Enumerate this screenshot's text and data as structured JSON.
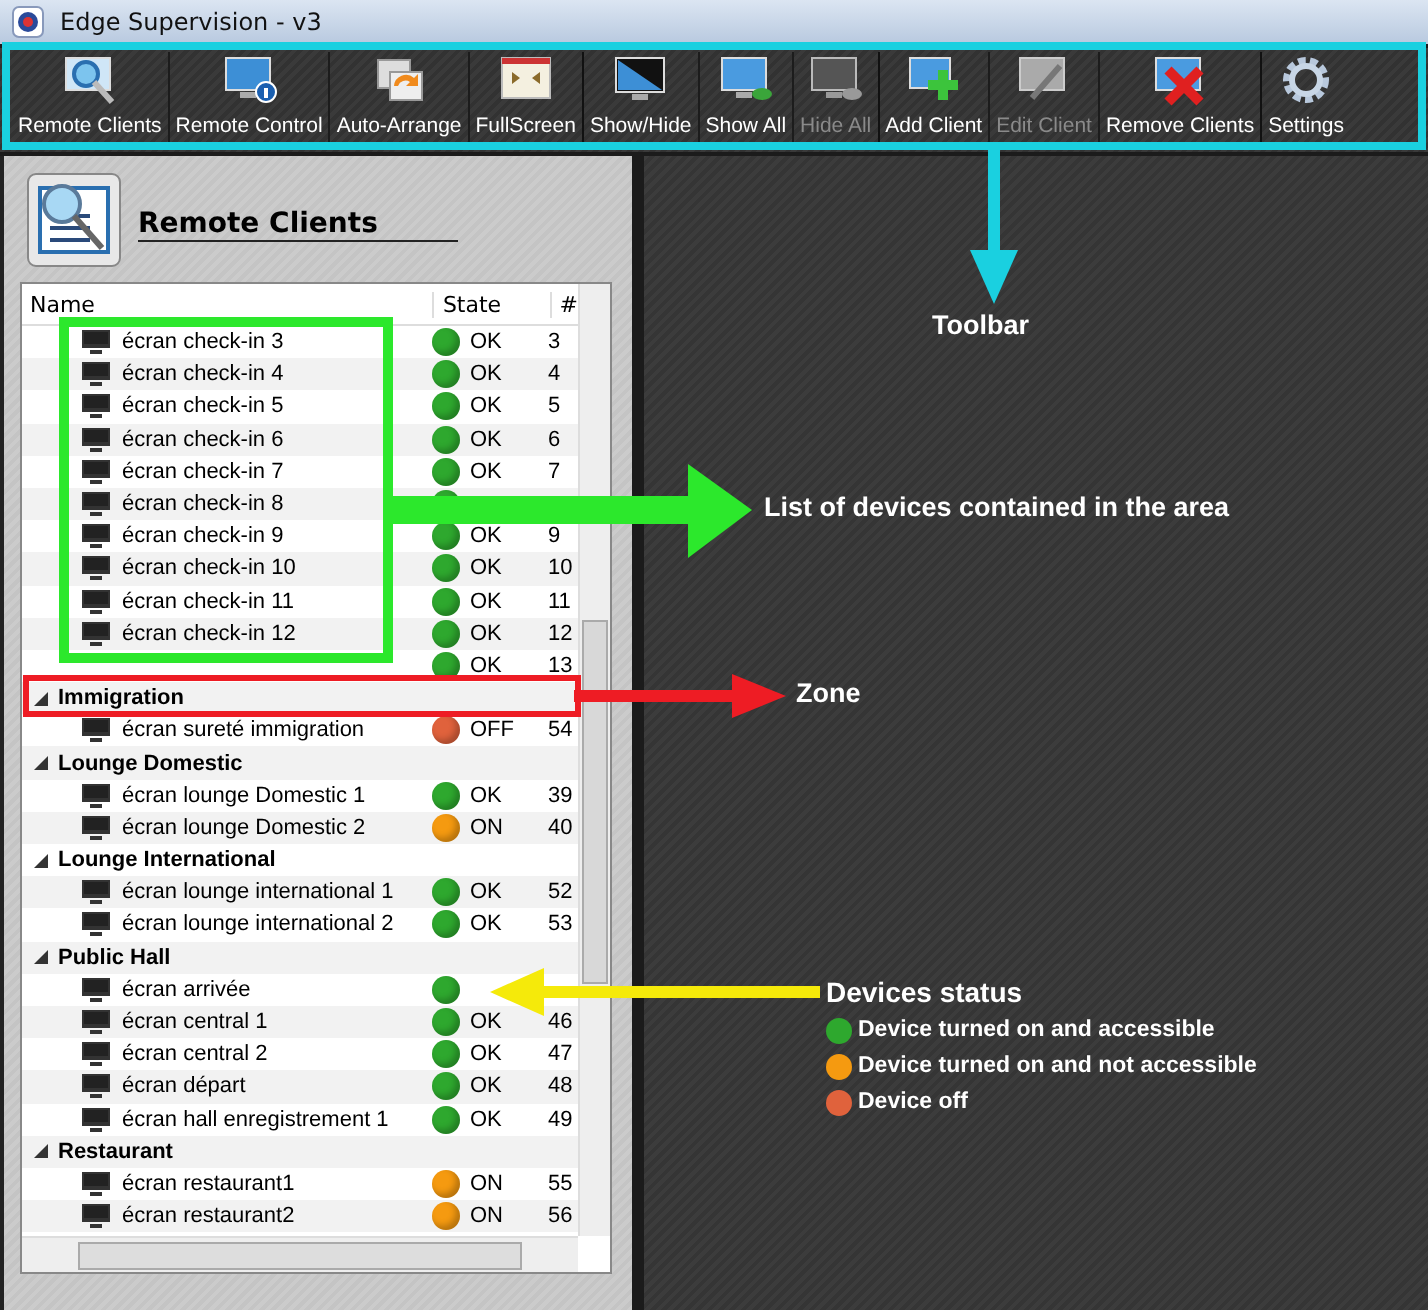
{
  "window": {
    "title": "Edge Supervision - v3"
  },
  "toolbar": {
    "groups": [
      [
        {
          "label": "Remote Clients",
          "kind": "search",
          "disabled": false
        },
        {
          "label": "Remote Control",
          "kind": "info",
          "disabled": false
        },
        {
          "label": "Auto-Arrange",
          "kind": "arrange",
          "disabled": false
        },
        {
          "label": "FullScreen",
          "kind": "fullscreen",
          "disabled": false
        }
      ],
      [
        {
          "label": "Show/Hide",
          "kind": "showhide",
          "disabled": false
        },
        {
          "label": "Show All",
          "kind": "showall",
          "disabled": false
        },
        {
          "label": "Hide All",
          "kind": "hideall",
          "disabled": true
        }
      ],
      [
        {
          "label": "Add Client",
          "kind": "add",
          "disabled": false
        },
        {
          "label": "Edit Client",
          "kind": "edit",
          "disabled": true
        },
        {
          "label": "Remove Clients",
          "kind": "remove",
          "disabled": false
        }
      ],
      [
        {
          "label": "Settings",
          "kind": "settings",
          "disabled": false
        }
      ]
    ]
  },
  "panel": {
    "title": "Remote Clients",
    "columns": [
      "Name",
      "State",
      "#"
    ],
    "tree": [
      {
        "kind": "device",
        "name": "écran check-in 3",
        "state": "OK",
        "number": "3",
        "color": "#2ea82e"
      },
      {
        "kind": "device",
        "name": "écran check-in 4",
        "state": "OK",
        "number": "4",
        "color": "#2ea82e"
      },
      {
        "kind": "device",
        "name": "écran check-in 5",
        "state": "OK",
        "number": "5",
        "color": "#2ea82e"
      },
      {
        "kind": "device",
        "name": "écran check-in 6",
        "state": "OK",
        "number": "6",
        "color": "#2ea82e"
      },
      {
        "kind": "device",
        "name": "écran check-in 7",
        "state": "OK",
        "number": "7",
        "color": "#2ea82e"
      },
      {
        "kind": "device",
        "name": "écran check-in 8",
        "color": "#2ea82e"
      },
      {
        "kind": "device",
        "name": "écran check-in 9",
        "state": "OK",
        "number": "9",
        "color": "#2ea82e"
      },
      {
        "kind": "device",
        "name": "écran check-in 10",
        "state": "OK",
        "number": "10",
        "color": "#2ea82e"
      },
      {
        "kind": "device",
        "name": "écran check-in 11",
        "state": "OK",
        "number": "11",
        "color": "#2ea82e"
      },
      {
        "kind": "device",
        "name": "écran check-in 12",
        "state": "OK",
        "number": "12",
        "color": "#2ea82e"
      },
      {
        "kind": "device",
        "state": "OK",
        "number": "13",
        "color": "#2ea82e"
      },
      {
        "kind": "zone",
        "label": "Immigration",
        "expanded": true,
        "children": [
          {
            "kind": "device",
            "name": "écran sureté immigration",
            "state": "OFF",
            "number": "54",
            "color": "#e0623c"
          }
        ]
      },
      {
        "kind": "zone",
        "label": "Lounge Domestic",
        "expanded": true,
        "children": [
          {
            "kind": "device",
            "name": "écran lounge Domestic 1",
            "state": "OK",
            "number": "39",
            "color": "#2ea82e"
          },
          {
            "kind": "device",
            "name": "écran lounge Domestic 2",
            "state": "ON",
            "number": "40",
            "color": "#f59a10"
          }
        ]
      },
      {
        "kind": "zone",
        "label": "Lounge International",
        "expanded": true,
        "children": [
          {
            "kind": "device",
            "name": "écran lounge international 1",
            "state": "OK",
            "number": "52",
            "color": "#2ea82e"
          },
          {
            "kind": "device",
            "name": "écran lounge international 2",
            "state": "OK",
            "number": "53",
            "color": "#2ea82e"
          }
        ]
      },
      {
        "kind": "zone",
        "label": "Public Hall",
        "expanded": true,
        "children": [
          {
            "kind": "device",
            "name": "écran arrivée",
            "color": "#2ea82e"
          },
          {
            "kind": "device",
            "name": "écran central 1",
            "state": "OK",
            "number": "46",
            "color": "#2ea82e"
          },
          {
            "kind": "device",
            "name": "écran central 2",
            "state": "OK",
            "number": "47",
            "color": "#2ea82e"
          },
          {
            "kind": "device",
            "name": "écran départ",
            "state": "OK",
            "number": "48",
            "color": "#2ea82e"
          },
          {
            "kind": "device",
            "name": "écran hall enregistrement 1",
            "state": "OK",
            "number": "49",
            "color": "#2ea82e"
          }
        ]
      },
      {
        "kind": "zone",
        "label": "Restaurant",
        "expanded": true,
        "children": [
          {
            "kind": "device",
            "name": "écran restaurant1",
            "state": "ON",
            "number": "55",
            "color": "#f59a10"
          },
          {
            "kind": "device",
            "name": "écran restaurant2",
            "state": "ON",
            "number": "56",
            "color": "#f59a10"
          }
        ]
      }
    ]
  },
  "annotations": {
    "toolbar": "Toolbar",
    "devices_list": "List of devices contained in the area",
    "zone": "Zone",
    "status": {
      "title": "Devices status",
      "legend": [
        {
          "label": "Device turned on and accessible",
          "color": "#2ea82e"
        },
        {
          "label": "Device turned on and not accessible",
          "color": "#f59a10"
        },
        {
          "label": "Device off",
          "color": "#e0623c"
        }
      ]
    }
  }
}
